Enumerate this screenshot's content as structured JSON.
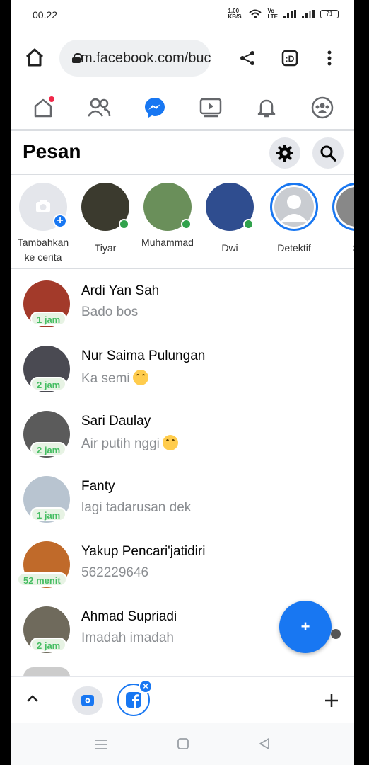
{
  "status_bar": {
    "time": "00.22",
    "net_speed": "1,00\nKB/S",
    "volte": "Vo\nLTE",
    "battery": "71"
  },
  "browser": {
    "url": "m.facebook.com/buc"
  },
  "page": {
    "title": "Pesan"
  },
  "stories": [
    {
      "label": "Tambahkan ke cerita",
      "type": "add"
    },
    {
      "label": "Tiyar",
      "online": true,
      "color": "#3b3a2e"
    },
    {
      "label": "Muhammad",
      "online": true,
      "color": "#6a8f5a"
    },
    {
      "label": "Dwi",
      "online": true,
      "color": "#2f4d8f"
    },
    {
      "label": "Detektif",
      "online": false,
      "color": "#c9ccd1"
    },
    {
      "label": "S",
      "online": false,
      "color": "#888"
    }
  ],
  "messages": [
    {
      "name": "Ardi Yan Sah",
      "snippet": "Bado bos",
      "time": "1 jam",
      "emoji": false,
      "color": "#a33a2a"
    },
    {
      "name": "Nur Saima Pulungan",
      "snippet": "Ka semi",
      "time": "2 jam",
      "emoji": true,
      "color": "#4a4a52"
    },
    {
      "name": "Sari Daulay",
      "snippet": "Air putih nggi",
      "time": "2 jam",
      "emoji": true,
      "color": "#5b5b5b"
    },
    {
      "name": "Fanty",
      "snippet": "lagi tadarusan dek",
      "time": "1 jam",
      "emoji": false,
      "color": "#b8c4d0"
    },
    {
      "name": "Yakup Pencari'jatidiri",
      "snippet": "562229646",
      "time": "52 menit",
      "emoji": false,
      "color": "#c06a2a"
    },
    {
      "name": "Ahmad Supriadi",
      "snippet": "Imadah imadah",
      "time": "2 jam",
      "emoji": false,
      "color": "#6f6a5c"
    }
  ],
  "fab": {
    "label": "+"
  },
  "colors": {
    "accent": "#1877f2",
    "online": "#31a24c",
    "notification": "#f02849"
  }
}
